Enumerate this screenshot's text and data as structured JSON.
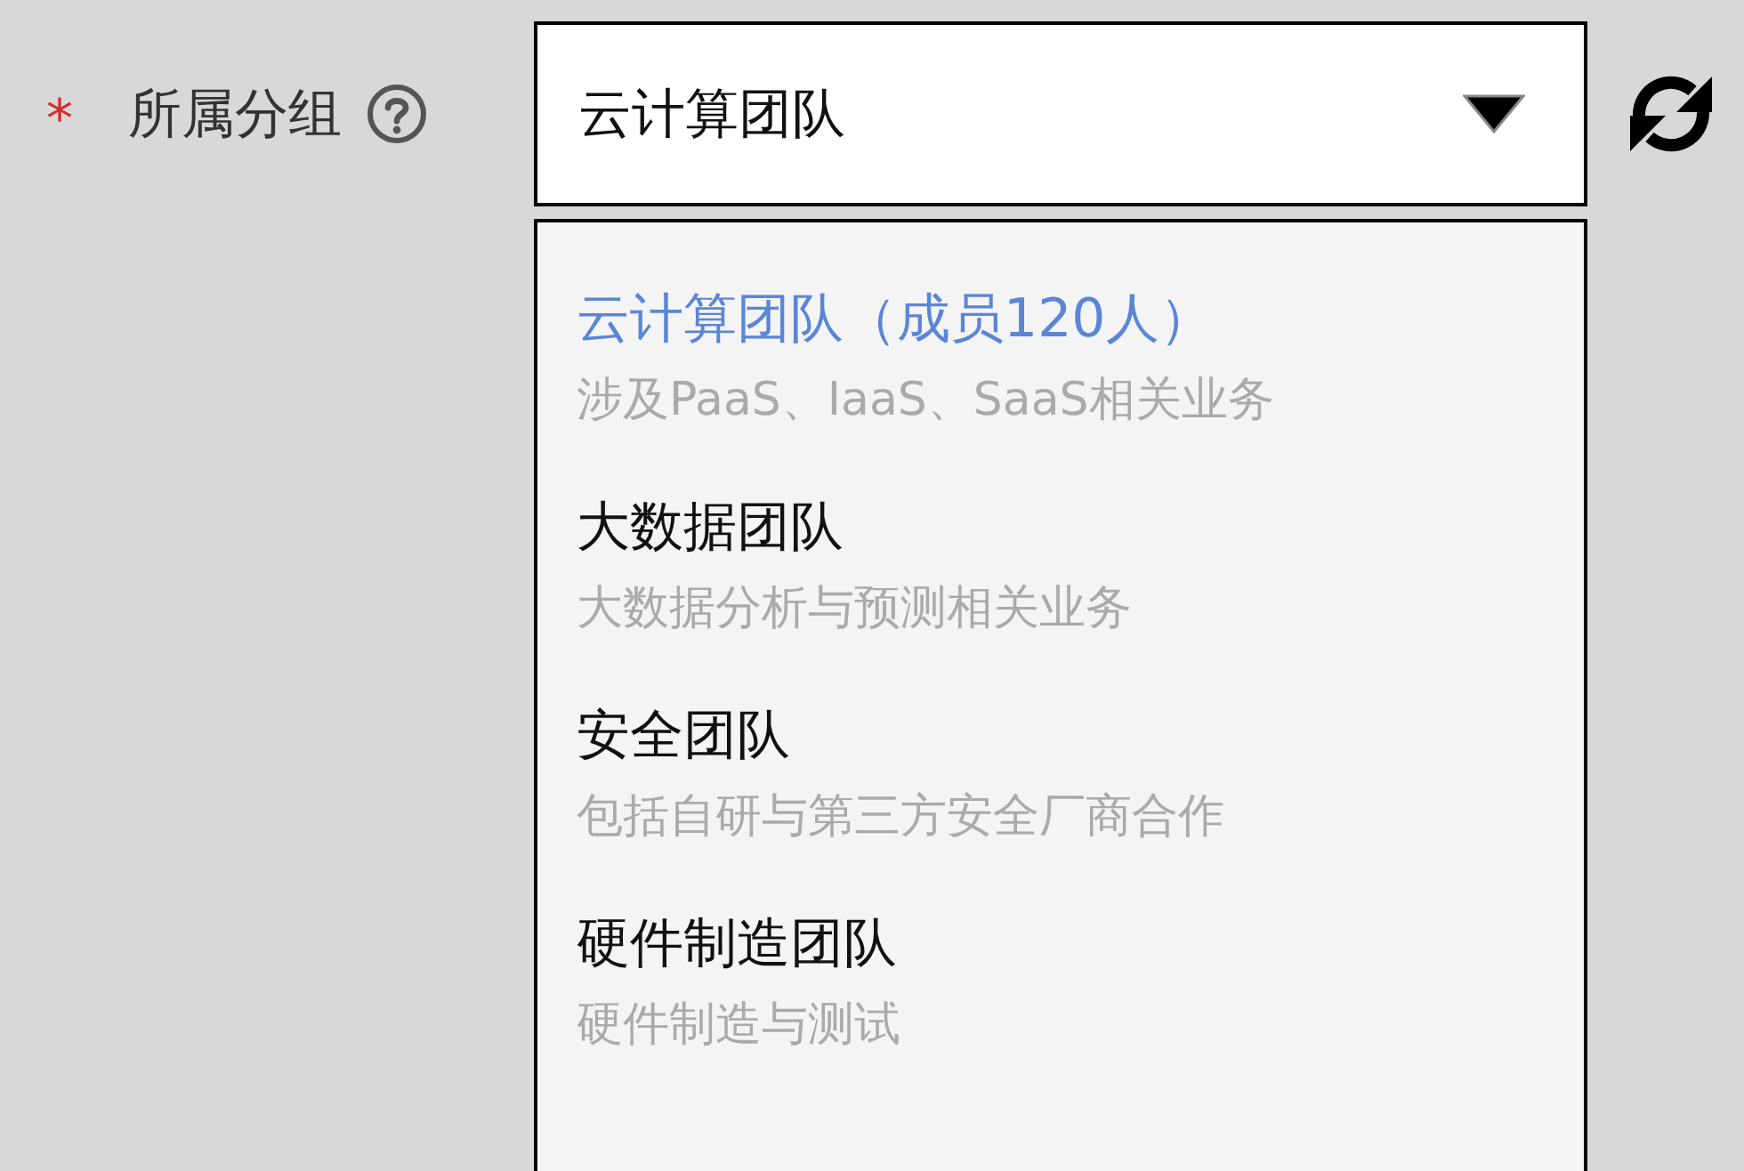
{
  "field": {
    "required_mark": "*",
    "label": "所属分组"
  },
  "select": {
    "value": "云计算团队",
    "expanded": true,
    "options": [
      {
        "title": "云计算团队（成员120人）",
        "description": "涉及PaaS、IaaS、SaaS相关业务",
        "selected": true
      },
      {
        "title": "大数据团队",
        "description": "大数据分析与预测相关业务",
        "selected": false
      },
      {
        "title": "安全团队",
        "description": "包括自研与第三方安全厂商合作",
        "selected": false
      },
      {
        "title": "硬件制造团队",
        "description": "硬件制造与测试",
        "selected": false
      }
    ]
  }
}
